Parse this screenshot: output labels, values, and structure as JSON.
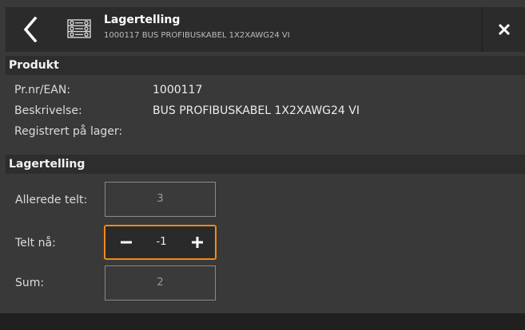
{
  "header": {
    "title": "Lagertelling",
    "subtitle": "1000117 BUS PROFIBUSKABEL 1X2XAWG24 VI",
    "back_icon": "chevron-left-icon",
    "app_icon": "inventory-list-icon",
    "close_icon": "close-icon"
  },
  "product": {
    "heading": "Produkt",
    "rows": [
      {
        "label": "Pr.nr/EAN:",
        "value": "1000117"
      },
      {
        "label": "Beskrivelse:",
        "value": "BUS PROFIBUSKABEL 1X2XAWG24 VI"
      },
      {
        "label": "Registrert på lager:",
        "value": ""
      }
    ]
  },
  "count": {
    "heading": "Lagertelling",
    "already_counted_label": "Allerede telt:",
    "already_counted_value": "3",
    "counted_now_label": "Telt nå:",
    "counted_now_value": "-1",
    "sum_label": "Sum:",
    "sum_value": "2"
  },
  "colors": {
    "accent": "#f08a1a",
    "background": "#393939",
    "header_bg": "#2b2b2b"
  }
}
